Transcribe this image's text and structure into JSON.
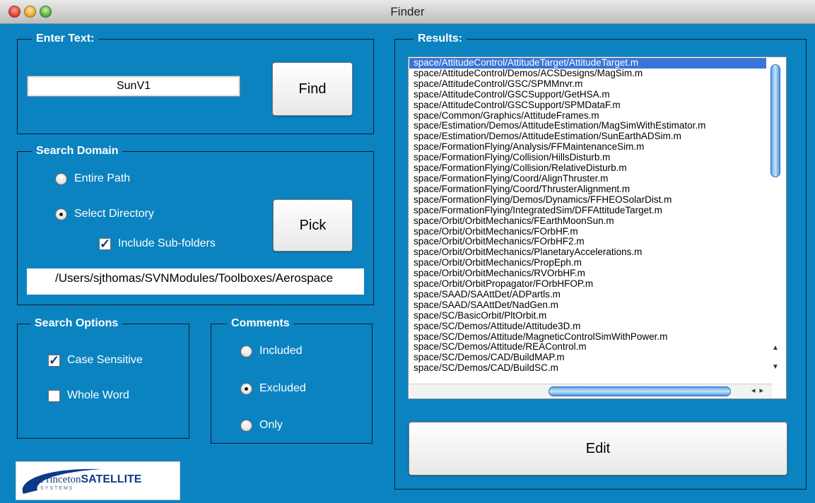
{
  "window": {
    "title": "Finder"
  },
  "enter_text": {
    "title": "Enter Text:",
    "value": "SunV1",
    "find_label": "Find"
  },
  "search_domain": {
    "title": "Search Domain",
    "entire_path_label": "Entire Path",
    "entire_path_selected": false,
    "select_directory_label": "Select Directory",
    "select_directory_selected": true,
    "include_subfolders_label": "Include Sub-folders",
    "include_subfolders_checked": true,
    "pick_label": "Pick",
    "path": "/Users/sjthomas/SVNModules/Toolboxes/Aerospace"
  },
  "search_options": {
    "title": "Search Options",
    "case_sensitive_label": "Case Sensitive",
    "case_sensitive_checked": true,
    "whole_word_label": "Whole Word",
    "whole_word_checked": false
  },
  "comments": {
    "title": "Comments",
    "included_label": "Included",
    "excluded_label": "Excluded",
    "only_label": "Only",
    "selected": "Excluded"
  },
  "results": {
    "title": "Results:",
    "selected_index": 0,
    "items": [
      "space/AttitudeControl/AttitudeTarget/AttitudeTarget.m",
      "space/AttitudeControl/Demos/ACSDesigns/MagSim.m",
      "space/AttitudeControl/GSC/SPMMnvr.m",
      "space/AttitudeControl/GSCSupport/GetHSA.m",
      "space/AttitudeControl/GSCSupport/SPMDataF.m",
      "space/Common/Graphics/AttitudeFrames.m",
      "space/Estimation/Demos/AttitudeEstimation/MagSimWithEstimator.m",
      "space/Estimation/Demos/AttitudeEstimation/SunEarthADSim.m",
      "space/FormationFlying/Analysis/FFMaintenanceSim.m",
      "space/FormationFlying/Collision/HillsDisturb.m",
      "space/FormationFlying/Collision/RelativeDisturb.m",
      "space/FormationFlying/Coord/AlignThruster.m",
      "space/FormationFlying/Coord/ThrusterAlignment.m",
      "space/FormationFlying/Demos/Dynamics/FFHEOSolarDist.m",
      "space/FormationFlying/IntegratedSim/DFFAttitudeTarget.m",
      "space/Orbit/OrbitMechanics/FEarthMoonSun.m",
      "space/Orbit/OrbitMechanics/FOrbHF.m",
      "space/Orbit/OrbitMechanics/FOrbHF2.m",
      "space/Orbit/OrbitMechanics/PlanetaryAccelerations.m",
      "space/Orbit/OrbitMechanics/PropEph.m",
      "space/Orbit/OrbitMechanics/RVOrbHF.m",
      "space/Orbit/OrbitPropagator/FOrbHFOP.m",
      "space/SAAD/SAAttDet/ADPartls.m",
      "space/SAAD/SAAttDet/NadGen.m",
      "space/SC/BasicOrbit/PltOrbit.m",
      "space/SC/Demos/Attitude/Attitude3D.m",
      "space/SC/Demos/Attitude/MagneticControlSimWithPower.m",
      "space/SC/Demos/Attitude/REAControl.m",
      "space/SC/Demos/CAD/BuildMAP.m",
      "space/SC/Demos/CAD/BuildSC.m"
    ],
    "edit_label": "Edit"
  },
  "logo": {
    "text_regular": "Princeton",
    "text_bold": "SATELLITE",
    "sub": "SYSTEMS"
  },
  "colors": {
    "background": "#0b83c0",
    "selection": "#3875d7"
  }
}
